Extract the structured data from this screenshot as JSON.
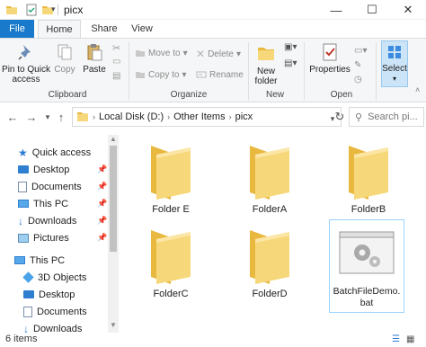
{
  "window": {
    "title": "picx",
    "minimize_glyph": "—",
    "maximize_glyph": "☐",
    "close_glyph": "✕"
  },
  "tabs": [
    {
      "label": "File"
    },
    {
      "label": "Home"
    },
    {
      "label": "Share"
    },
    {
      "label": "View"
    }
  ],
  "ribbon": {
    "clipboard": {
      "pin_label_1": "Pin to Quick",
      "pin_label_2": "access",
      "copy_label": "Copy",
      "paste_label": "Paste",
      "group_label": "Clipboard"
    },
    "organize": {
      "move_to_label": "Move to",
      "copy_to_label": "Copy to",
      "delete_label": "Delete",
      "rename_label": "Rename",
      "group_label": "Organize"
    },
    "new": {
      "new_folder_label_1": "New",
      "new_folder_label_2": "folder",
      "group_label": "New"
    },
    "open": {
      "properties_label": "Properties",
      "group_label": "Open"
    },
    "select": {
      "select_label": "Select"
    }
  },
  "address": {
    "segments": [
      "Local Disk (D:)",
      "Other Items",
      "picx"
    ],
    "search_placeholder": "Search pi..."
  },
  "navpane": {
    "items": [
      {
        "label": "Quick access",
        "icon": "star-icon",
        "pinned": false
      },
      {
        "label": "Desktop",
        "icon": "desktop-icon",
        "pinned": true
      },
      {
        "label": "Documents",
        "icon": "documents-icon",
        "pinned": true
      },
      {
        "label": "This PC",
        "icon": "computer-icon",
        "pinned": true
      },
      {
        "label": "Downloads",
        "icon": "downloads-icon",
        "pinned": true
      },
      {
        "label": "Pictures",
        "icon": "pictures-icon",
        "pinned": true
      },
      {
        "label": "This PC",
        "icon": "computer-icon",
        "pinned": false
      },
      {
        "label": "3D Objects",
        "icon": "3d-objects-icon",
        "pinned": false
      },
      {
        "label": "Desktop",
        "icon": "desktop-icon",
        "pinned": false
      },
      {
        "label": "Documents",
        "icon": "documents-icon",
        "pinned": false
      },
      {
        "label": "Downloads",
        "icon": "downloads-icon",
        "pinned": false
      }
    ],
    "pin_glyph": "📌"
  },
  "files": [
    {
      "name": "Folder E",
      "type": "folder"
    },
    {
      "name": "FolderA",
      "type": "folder"
    },
    {
      "name": "FolderB",
      "type": "folder"
    },
    {
      "name": "FolderC",
      "type": "folder"
    },
    {
      "name": "FolderD",
      "type": "folder"
    },
    {
      "name": "BatchFileDemo.bat",
      "type": "batch-file"
    }
  ],
  "status": {
    "item_count": "6 items"
  },
  "colors": {
    "accent": "#1979ca",
    "folder": "#f6d87a",
    "folder_dark": "#e8b83f",
    "selection_border": "#99d1ff"
  }
}
